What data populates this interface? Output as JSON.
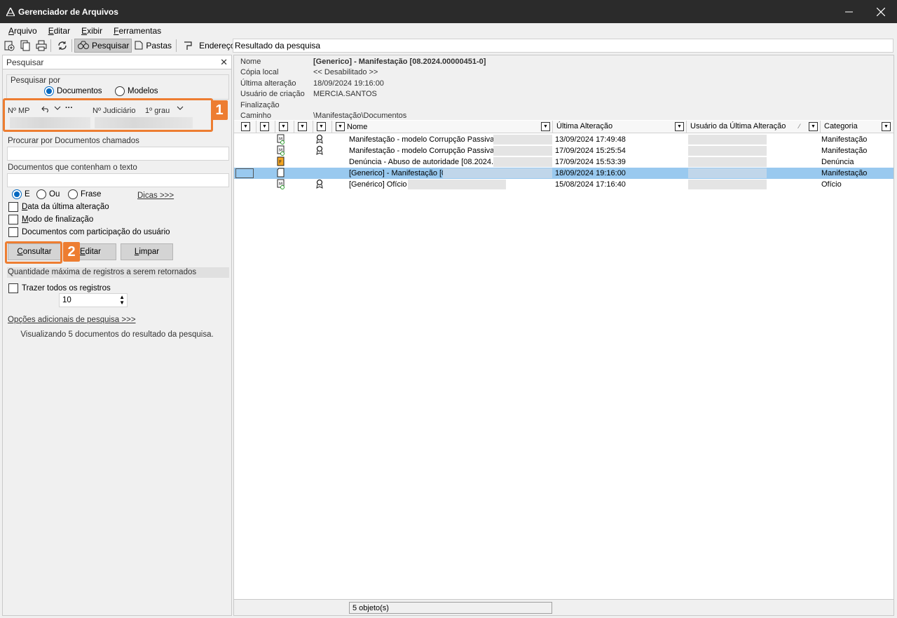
{
  "window": {
    "title": "Gerenciador de Arquivos"
  },
  "menu": [
    "Arquivo",
    "Editar",
    "Exibir",
    "Ferramentas"
  ],
  "toolbar": {
    "search_label": "Pesquisar",
    "folders_label": "Pastas",
    "address_label": "Endereço",
    "address_value": "Resultado da pesquisa"
  },
  "search_panel": {
    "title": "Pesquisar",
    "search_by_label": "Pesquisar por",
    "option_documents": "Documentos",
    "option_models": "Modelos",
    "mp_label": "Nº MP",
    "judicial_label": "Nº Judiciário",
    "instance_value": "1º grau",
    "named_docs_label": "Procurar por Documentos chamados",
    "text_docs_label": "Documentos que contenham o texto",
    "logic_and": "E",
    "logic_or": "Ou",
    "logic_phrase": "Frase",
    "tips_link": "Dicas >>>",
    "chk_last_change": "Data da última alteração",
    "chk_finalization": "Modo de finalização",
    "chk_user_participation": "Documentos com participação do usuário",
    "btn_consult": "Consultar",
    "btn_edit": "Editar",
    "btn_clear": "Limpar",
    "max_records_label": "Quantidade máxima de registros a serem retornados",
    "chk_all_records": "Trazer todos os registros",
    "max_records_value": "10",
    "more_options_link": "Opções adicionais de pesquisa >>>",
    "status": "Visualizando 5 documentos do resultado da pesquisa.",
    "badge1": "1",
    "badge2": "2"
  },
  "details": {
    "name_key": "Nome",
    "name_value": "[Generico] - Manifestação [08.2024.00000451-0]",
    "local_copy_key": "Cópia local",
    "local_copy_value": "<< Desabilitado >>",
    "last_change_key": "Última alteração",
    "last_change_value": "18/09/2024 19:16:00",
    "creator_key": "Usuário de criação",
    "creator_value": "MERCIA.SANTOS",
    "finalization_key": "Finalização",
    "finalization_value": "",
    "path_key": "Caminho",
    "path_value": "\\Manifestação\\Documentos"
  },
  "grid": {
    "columns": {
      "name": "Nome",
      "last_change": "Última Alteração",
      "last_user": "Usuário da Última Alteração",
      "category": "Categoria"
    },
    "rows": [
      {
        "name": "Manifestação - modelo Corrupção Passiva [",
        "date": "13/09/2024 17:49:48",
        "category": "Manifestação"
      },
      {
        "name": "Manifestação - modelo Corrupção Passiva [",
        "date": "17/09/2024 15:25:54",
        "category": "Manifestação"
      },
      {
        "name": "Denúncia - Abuso de autoridade [08.2024.",
        "date": "17/09/2024 15:53:39",
        "category": "Denúncia"
      },
      {
        "name": "[Generico] - Manifestação [0",
        "date": "18/09/2024 19:16:00",
        "category": "Manifestação"
      },
      {
        "name": "[Genérico] Ofício",
        "date": "15/08/2024 17:16:40",
        "category": "Ofício"
      }
    ]
  },
  "statusbar": {
    "count": "5 objeto(s)"
  }
}
